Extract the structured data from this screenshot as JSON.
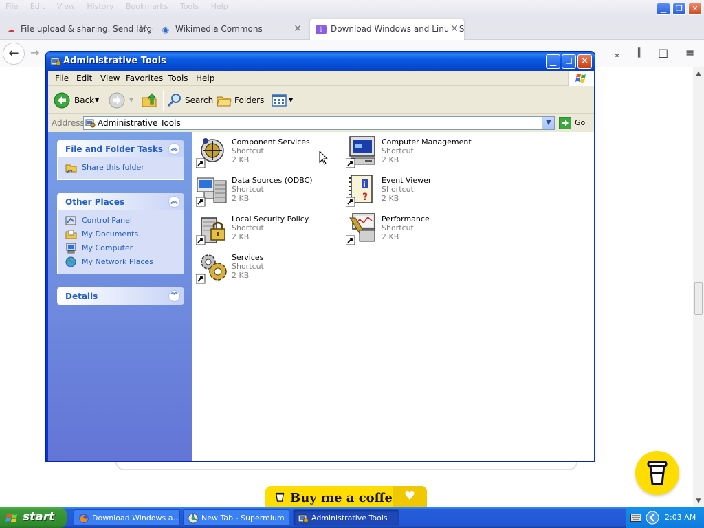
{
  "browser": {
    "menu": [
      "File",
      "Edit",
      "View",
      "History",
      "Bookmarks",
      "Tools",
      "Help"
    ],
    "tabs": [
      {
        "label": "File upload & sharing. Send large",
        "icon": "cloud-icon"
      },
      {
        "label": "Wikimedia Commons",
        "icon": "wikimedia-icon"
      },
      {
        "label": "Download Windows and Linux ISO",
        "icon": "download-icon",
        "active": true
      }
    ],
    "new_tab": "+",
    "page": {
      "coffee_button": "Buy me a coffee"
    }
  },
  "window": {
    "title": "Administrative Tools",
    "menu": [
      "File",
      "Edit",
      "View",
      "Favorites",
      "Tools",
      "Help"
    ],
    "toolbar": {
      "back": "Back",
      "search": "Search",
      "folders": "Folders"
    },
    "address": {
      "label": "Address",
      "value": "Administrative Tools",
      "go": "Go"
    },
    "left_panels": {
      "file_tasks": {
        "title": "File and Folder Tasks",
        "items": [
          "Share this folder"
        ]
      },
      "other_places": {
        "title": "Other Places",
        "items": [
          "Control Panel",
          "My Documents",
          "My Computer",
          "My Network Places"
        ]
      },
      "details": {
        "title": "Details"
      }
    },
    "files": [
      {
        "name": "Component Services",
        "type": "Shortcut",
        "size": "2 KB",
        "icon": "component-services-icon"
      },
      {
        "name": "Computer Management",
        "type": "Shortcut",
        "size": "2 KB",
        "icon": "computer-management-icon"
      },
      {
        "name": "Data Sources (ODBC)",
        "type": "Shortcut",
        "size": "2 KB",
        "icon": "data-sources-icon"
      },
      {
        "name": "Event Viewer",
        "type": "Shortcut",
        "size": "2 KB",
        "icon": "event-viewer-icon"
      },
      {
        "name": "Local Security Policy",
        "type": "Shortcut",
        "size": "2 KB",
        "icon": "security-policy-icon"
      },
      {
        "name": "Performance",
        "type": "Shortcut",
        "size": "2 KB",
        "icon": "performance-icon"
      },
      {
        "name": "Services",
        "type": "Shortcut",
        "size": "2 KB",
        "icon": "services-icon"
      }
    ]
  },
  "taskbar": {
    "start": "start",
    "tasks": [
      {
        "label": "Download Windows a...",
        "icon": "firefox-icon"
      },
      {
        "label": "New Tab - Supermium",
        "icon": "supermium-icon"
      },
      {
        "label": "Administrative Tools",
        "icon": "admin-tools-icon",
        "active": true
      }
    ],
    "clock": "2:03 AM"
  },
  "colors": {
    "xp_blue": "#0831d9",
    "taskbar_blue": "#245edb",
    "start_green": "#3c9a38",
    "panel_link": "#215dc6",
    "coffee_yellow": "#ffdd00"
  }
}
